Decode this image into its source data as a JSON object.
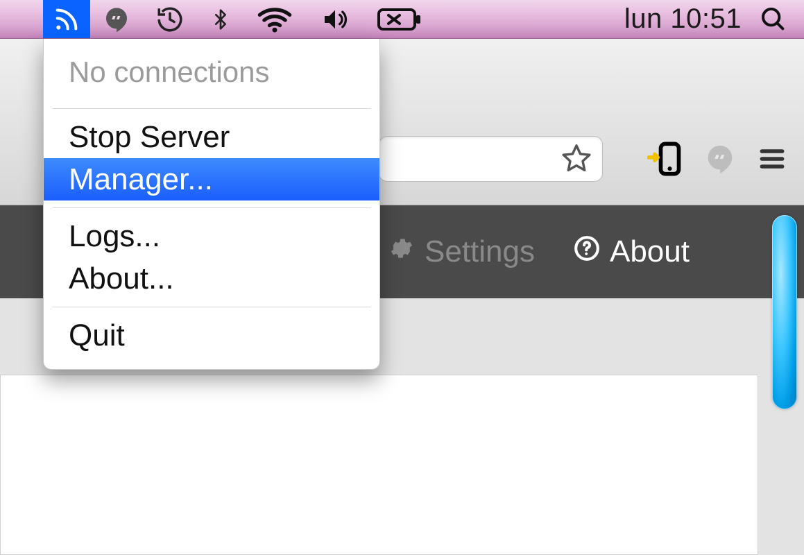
{
  "menubar": {
    "clock": "lun 10:51",
    "icons": {
      "rss": "rss-icon",
      "hangouts": "hangouts-icon",
      "timemachine": "timemachine-icon",
      "bluetooth": "bluetooth-icon",
      "wifi": "wifi-icon",
      "volume": "volume-icon",
      "battery": "battery-icon",
      "spotlight": "spotlight-icon"
    }
  },
  "dropdown": {
    "header": "No connections",
    "items": {
      "stop_server": "Stop Server",
      "manager": "Manager...",
      "logs": "Logs...",
      "about": "About...",
      "quit": "Quit"
    },
    "selected_key": "manager"
  },
  "browser": {
    "icons": {
      "star": "star-icon",
      "phone_push": "phone-push-icon",
      "hangouts_ext": "hangouts-ext-icon",
      "menu": "hamburger-menu-icon"
    }
  },
  "page_nav": {
    "settings_label": "Settings",
    "about_label": "About"
  },
  "colors": {
    "selection": "#1a5efc",
    "menubar_tint": "#eac2e3",
    "page_nav_bg": "#4a4a4a",
    "scrollbar_thumb": "#3cc6ff"
  }
}
